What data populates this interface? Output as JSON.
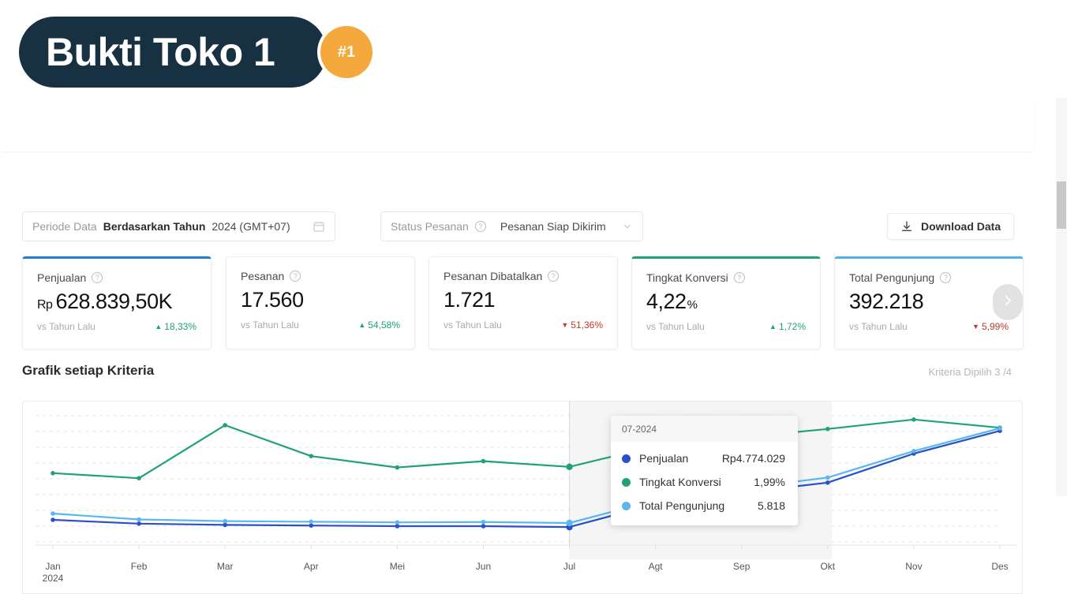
{
  "banner": {
    "title": "Bukti Toko 1",
    "badge": "#1"
  },
  "filters": {
    "periode_label": "Periode Data",
    "periode_mode": "Berdasarkan Tahun",
    "periode_value": "2024 (GMT+07)",
    "calendar_icon": "calendar-icon",
    "status_label": "Status Pesanan",
    "status_help_icon": "help-circle-icon",
    "status_value": "Pesanan Siap Dikirim",
    "status_chevron_icon": "chevron-down-icon",
    "download_label": "Download Data",
    "download_icon": "download-icon"
  },
  "kpis": [
    {
      "title": "Penjualan",
      "help_icon": "help-circle-icon",
      "prefix": "Rp",
      "value": "628.839,50K",
      "suffix": "",
      "compare_label": "vs Tahun Lalu",
      "delta": "18,33%",
      "direction": "up",
      "accent": "#1E7BD6",
      "selected": true
    },
    {
      "title": "Pesanan",
      "help_icon": "help-circle-icon",
      "prefix": "",
      "value": "17.560",
      "suffix": "",
      "compare_label": "vs Tahun Lalu",
      "delta": "54,58%",
      "direction": "up",
      "accent": "",
      "selected": false
    },
    {
      "title": "Pesanan Dibatalkan",
      "help_icon": "help-circle-icon",
      "prefix": "",
      "value": "1.721",
      "suffix": "",
      "compare_label": "vs Tahun Lalu",
      "delta": "51,36%",
      "direction": "down",
      "accent": "",
      "selected": false
    },
    {
      "title": "Tingkat Konversi",
      "help_icon": "help-circle-icon",
      "prefix": "",
      "value": "4,22",
      "suffix": "%",
      "compare_label": "vs Tahun Lalu",
      "delta": "1,72%",
      "direction": "up",
      "accent": "#21A179",
      "selected": true
    },
    {
      "title": "Total Pengunjung",
      "help_icon": "help-circle-icon",
      "prefix": "",
      "value": "392.218",
      "suffix": "",
      "compare_label": "vs Tahun Lalu",
      "delta": "5,99%",
      "direction": "down",
      "accent": "#4FB3E8",
      "selected": true
    }
  ],
  "carousel": {
    "next_icon": "chevron-right-icon"
  },
  "chart_section": {
    "title": "Grafik setiap Kriteria",
    "meta": "Kriteria Dipilih 3 /4"
  },
  "tooltip": {
    "period": "07-2024",
    "rows": [
      {
        "name": "Penjualan",
        "value": "Rp4.774.029",
        "color": "#2A51C8"
      },
      {
        "name": "Tingkat Konversi",
        "value": "1,99%",
        "color": "#21A179"
      },
      {
        "name": "Total Pengunjung",
        "value": "5.818",
        "color": "#5BB7EE"
      }
    ]
  },
  "chart_data": {
    "type": "line",
    "title": "Grafik setiap Kriteria",
    "xlabel": "",
    "ylabel": "",
    "grid": true,
    "legend": "none",
    "axis_year": "2024",
    "categories": [
      "Jan",
      "Feb",
      "Mar",
      "Apr",
      "Mei",
      "Jun",
      "Jul",
      "Agt",
      "Sep",
      "Okt",
      "Nov",
      "Des"
    ],
    "hover_index": 6,
    "series": [
      {
        "name": "Penjualan",
        "color": "#2A51C8",
        "unit": "Rp",
        "normalized": [
          0.175,
          0.145,
          0.135,
          0.13,
          0.125,
          0.125,
          0.118,
          0.3,
          0.39,
          0.47,
          0.7,
          0.88
        ]
      },
      {
        "name": "Tingkat Konversi",
        "color": "#21A179",
        "unit": "%",
        "normalized": [
          0.545,
          0.505,
          0.925,
          0.68,
          0.59,
          0.64,
          0.595,
          0.76,
          0.83,
          0.895,
          0.97,
          0.905
        ]
      },
      {
        "name": "Total Pengunjung",
        "color": "#5BB7EE",
        "unit": "",
        "normalized": [
          0.225,
          0.178,
          0.165,
          0.16,
          0.155,
          0.158,
          0.15,
          0.33,
          0.425,
          0.51,
          0.72,
          0.9
        ]
      }
    ]
  }
}
